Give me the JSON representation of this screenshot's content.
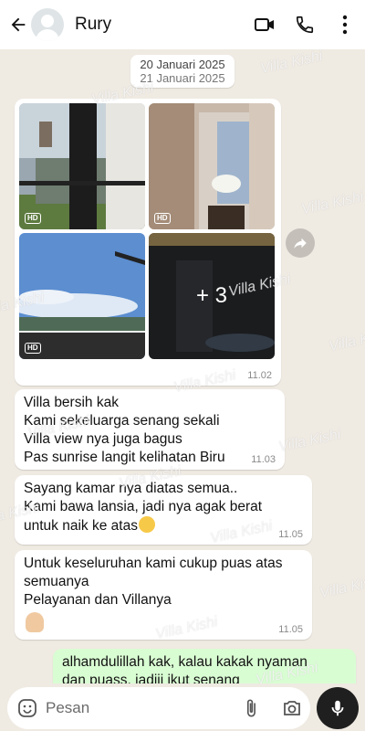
{
  "header": {
    "contact_name": "Rury",
    "icons": [
      "back-arrow-icon",
      "avatar",
      "video-call-icon",
      "phone-icon",
      "more-vert-icon"
    ]
  },
  "chat": {
    "date_label": "20 Januari 2025",
    "date_label_overlap": "21 Januari 2025",
    "album": {
      "more_count": "+ 3",
      "hd_label": "HD",
      "time": "11.02"
    },
    "messages": [
      {
        "text": "Villa bersih kak\nKami sekeluarga senang sekali\nVilla view nya juga bagus\nPas sunrise langit kelihatan Biru",
        "time": "11.03"
      },
      {
        "text": "Sayang kamar nya diatas semua..\nKami bawa lansia, jadi nya agak berat\nuntuk naik ke atas",
        "emoji": "sweat-smile",
        "time": "11.05"
      },
      {
        "text": "Untuk keseluruhan kami cukup puas atas\nsemuanya\nPelayanan dan Villanya",
        "emoji": "pinched-fingers",
        "time": "11.05"
      }
    ],
    "outgoing": {
      "text": "alhamdulillah kak, kalau kakak nyaman\ndan puass, jadiii ikut senang"
    }
  },
  "watermark": "Villa Kishi",
  "input": {
    "placeholder": "Pesan",
    "icons": [
      "emoji-icon",
      "attach-icon",
      "camera-icon",
      "mic-icon"
    ]
  },
  "colors": {
    "background": "#efeae2",
    "outgoing_bubble": "#d9fdd3",
    "incoming_bubble": "#ffffff"
  }
}
